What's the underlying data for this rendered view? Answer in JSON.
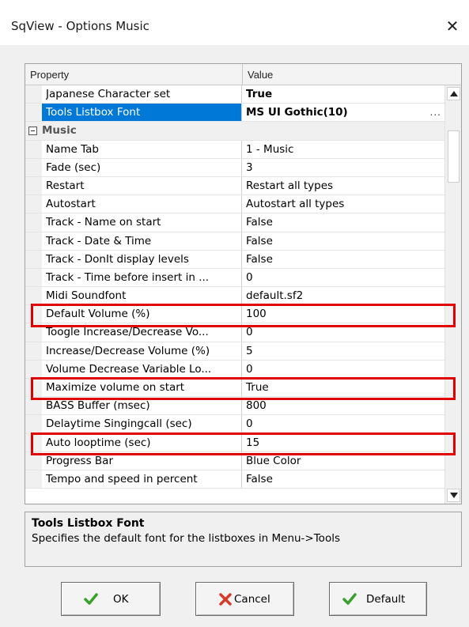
{
  "window": {
    "title": "SqView - Options Music",
    "close_glyph": "✕"
  },
  "grid": {
    "header_property": "Property",
    "header_value": "Value",
    "rows": [
      {
        "name": "Japanese Character set",
        "value": "True",
        "bold": true
      },
      {
        "name": "Tools Listbox Font",
        "value": "MS UI Gothic(10)",
        "bold": true,
        "selected": true,
        "ellipsis": "..."
      },
      {
        "name": "Music",
        "category": true
      },
      {
        "name": "Name Tab",
        "value": "1 - Music"
      },
      {
        "name": "Fade (sec)",
        "value": "3"
      },
      {
        "name": "Restart",
        "value": "Restart all types"
      },
      {
        "name": "Autostart",
        "value": "Autostart all types"
      },
      {
        "name": "Track - Name on start",
        "value": "False"
      },
      {
        "name": "Track - Date & Time",
        "value": "False"
      },
      {
        "name": "Track - DonIt display levels",
        "value": "False"
      },
      {
        "name": "Track - Time before insert in ...",
        "value": "0"
      },
      {
        "name": "Midi Soundfont",
        "value": "default.sf2"
      },
      {
        "name": "Default Volume (%)",
        "value": "100",
        "highlight": true
      },
      {
        "name": "Toogle Increase/Decrease Vo...",
        "value": "0"
      },
      {
        "name": "Increase/Decrease Volume (%)",
        "value": "5"
      },
      {
        "name": "Volume Decrease Variable Lo...",
        "value": "0"
      },
      {
        "name": "Maximize volume on start",
        "value": "True",
        "highlight": true
      },
      {
        "name": "BASS Buffer (msec)",
        "value": "800"
      },
      {
        "name": "Delaytime Singingcall (sec)",
        "value": "0"
      },
      {
        "name": "Auto looptime (sec)",
        "value": "15",
        "highlight": true
      },
      {
        "name": "Progress Bar",
        "value": "Blue Color"
      },
      {
        "name": "Tempo and speed in percent",
        "value": "False"
      }
    ]
  },
  "description": {
    "title": "Tools Listbox Font",
    "text": "Specifies the default font for the listboxes in Menu->Tools"
  },
  "buttons": {
    "ok": "OK",
    "cancel": "Cancel",
    "default": "Default"
  },
  "colors": {
    "selection": "#0078d7",
    "highlight_box": "#e00000",
    "check_green": "#3aa02c",
    "cancel_red": "#d83a2a"
  },
  "icons": {
    "ok": "green-check-icon",
    "cancel": "red-x-icon",
    "default": "green-check-icon"
  }
}
